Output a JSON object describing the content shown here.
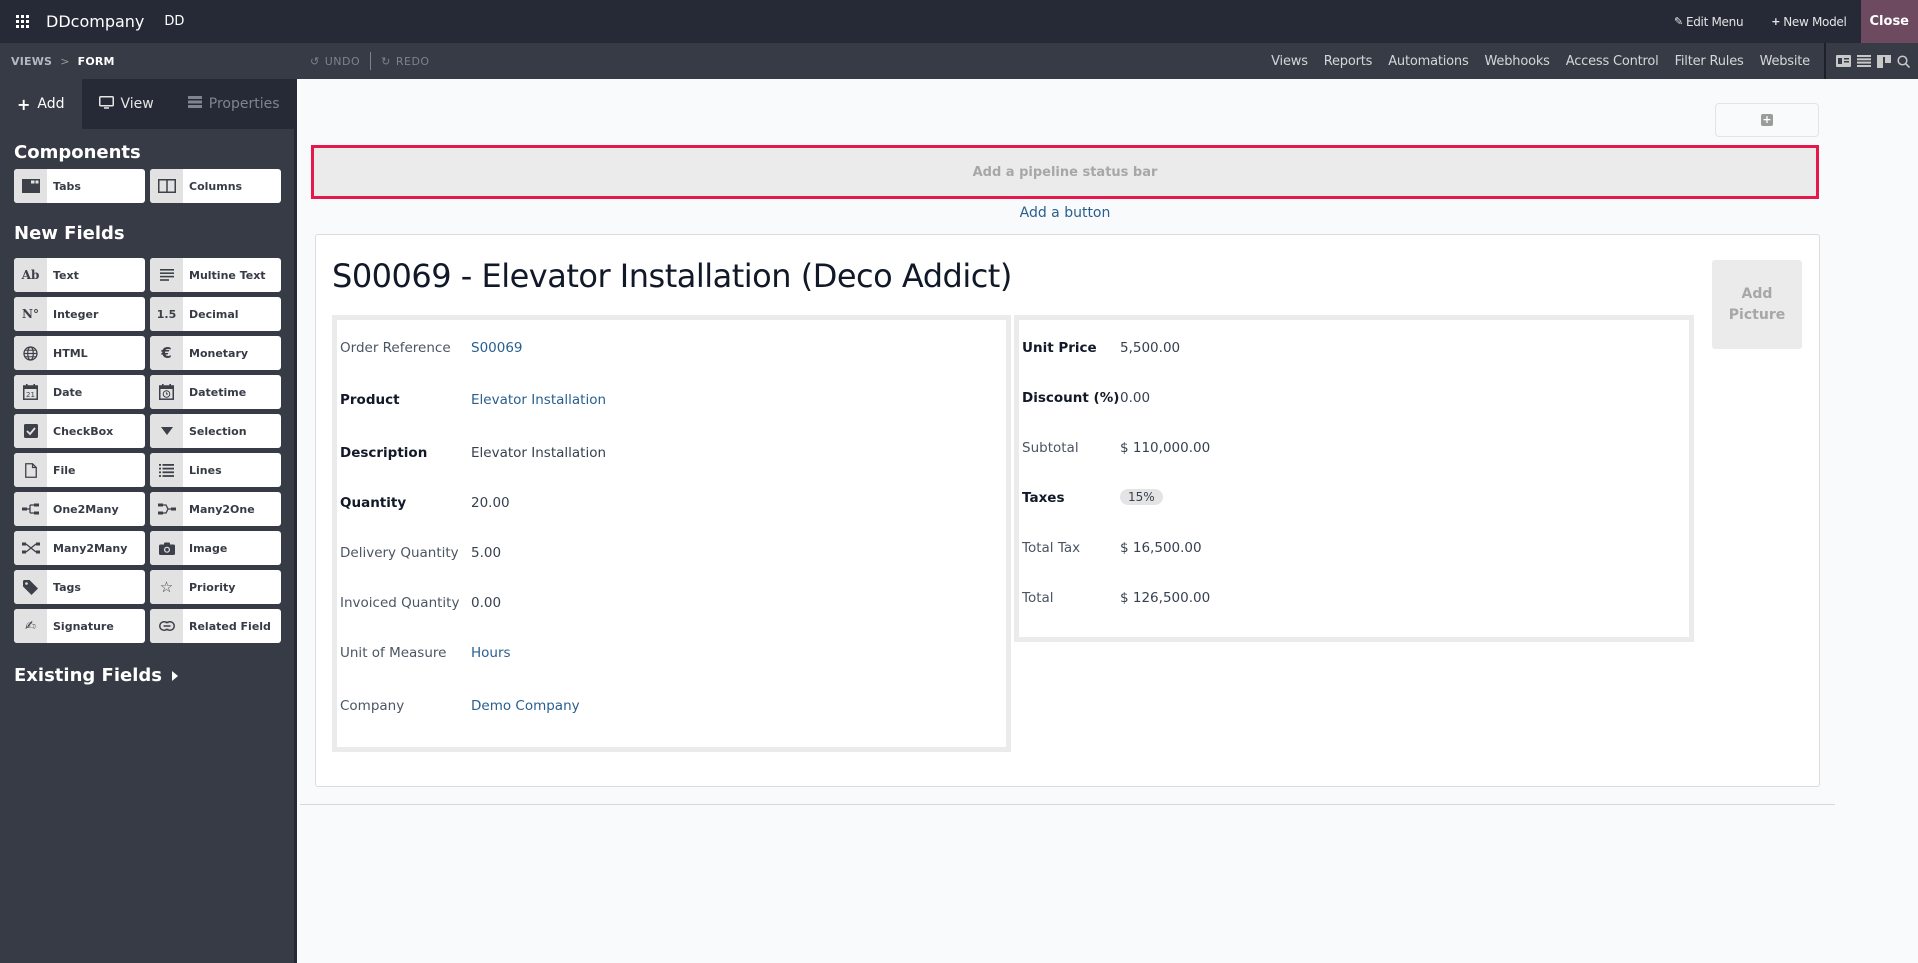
{
  "topbar": {
    "brand": "DDcompany",
    "company_short": "DD",
    "edit_menu": "Edit Menu",
    "new_model": "New Model",
    "close": "Close"
  },
  "subbar": {
    "breadcrumb": {
      "views": "VIEWS",
      "separator": ">",
      "form": "FORM"
    },
    "undo": "UNDO",
    "redo": "REDO",
    "menu": [
      "Views",
      "Reports",
      "Automations",
      "Webhooks",
      "Access Control",
      "Filter Rules",
      "Website"
    ],
    "view_icons": [
      "form-view-icon",
      "list-view-icon",
      "kanban-view-icon",
      "search-view-icon"
    ]
  },
  "sidebar": {
    "tabs": [
      {
        "label": "Add",
        "icon": "plus-icon",
        "state": "active"
      },
      {
        "label": "View",
        "icon": "monitor-icon",
        "state": "normal"
      },
      {
        "label": "Properties",
        "icon": "properties-icon",
        "state": "disabled"
      }
    ],
    "components_title": "Components",
    "components": [
      {
        "label": "Tabs",
        "icon": "tabs-icon"
      },
      {
        "label": "Columns",
        "icon": "columns-icon"
      }
    ],
    "new_fields_title": "New Fields",
    "new_fields": [
      {
        "label": "Text",
        "icon": "text-icon",
        "glyph": "Ab"
      },
      {
        "label": "Multine Text",
        "icon": "multiline-text-icon",
        "glyph": "≡"
      },
      {
        "label": "Integer",
        "icon": "integer-icon",
        "glyph": "N°"
      },
      {
        "label": "Decimal",
        "icon": "decimal-icon",
        "glyph": "1.5"
      },
      {
        "label": "HTML",
        "icon": "globe-icon",
        "glyph": "🌐"
      },
      {
        "label": "Monetary",
        "icon": "euro-icon",
        "glyph": "€"
      },
      {
        "label": "Date",
        "icon": "calendar-icon",
        "glyph": "21"
      },
      {
        "label": "Datetime",
        "icon": "calendar-clock-icon",
        "glyph": "◷"
      },
      {
        "label": "CheckBox",
        "icon": "checkbox-icon",
        "glyph": "☑"
      },
      {
        "label": "Selection",
        "icon": "caret-down-icon",
        "glyph": "▼"
      },
      {
        "label": "File",
        "icon": "file-icon",
        "glyph": "🗋"
      },
      {
        "label": "Lines",
        "icon": "list-icon",
        "glyph": "☰"
      },
      {
        "label": "One2Many",
        "icon": "one2many-icon",
        "glyph": "⋲"
      },
      {
        "label": "Many2One",
        "icon": "many2one-icon",
        "glyph": "⋺"
      },
      {
        "label": "Many2Many",
        "icon": "many2many-icon",
        "glyph": "⤨"
      },
      {
        "label": "Image",
        "icon": "camera-icon",
        "glyph": "📷"
      },
      {
        "label": "Tags",
        "icon": "tag-icon",
        "glyph": "🏷"
      },
      {
        "label": "Priority",
        "icon": "star-icon",
        "glyph": "☆"
      },
      {
        "label": "Signature",
        "icon": "signature-icon",
        "glyph": "✍"
      },
      {
        "label": "Related Field",
        "icon": "link-icon",
        "glyph": "⊂⊃"
      }
    ],
    "existing_fields_title": "Existing Fields"
  },
  "main": {
    "status_bar_placeholder": "Add a pipeline status bar",
    "add_button_link": "Add a button",
    "record_title": "S00069 - Elevator Installation (Deco Addict)",
    "add_picture": "Add Picture",
    "left_group": [
      {
        "label": "Order Reference",
        "value": "S00069",
        "bold": false,
        "link": true
      },
      {
        "label": "Product",
        "value": "Elevator Installation",
        "bold": true,
        "link": true
      },
      {
        "label": "Description",
        "value": "Elevator Installation",
        "bold": true,
        "link": false
      },
      {
        "label": "Quantity",
        "value": "20.00",
        "bold": true,
        "link": false
      },
      {
        "label": "Delivery Quantity",
        "value": "5.00",
        "bold": false,
        "link": false
      },
      {
        "label": "Invoiced Quantity",
        "value": "0.00",
        "bold": false,
        "link": false
      },
      {
        "label": "Unit of Measure",
        "value": "Hours",
        "bold": false,
        "link": true
      },
      {
        "label": "Company",
        "value": "Demo Company",
        "bold": false,
        "link": true
      }
    ],
    "right_group": [
      {
        "label": "Unit Price",
        "value": "5,500.00",
        "bold": true
      },
      {
        "label": "Discount (%)",
        "value": "0.00",
        "bold": true
      },
      {
        "label": "Subtotal",
        "value": "$ 110,000.00",
        "bold": false
      },
      {
        "label": "Taxes",
        "value": "15%",
        "bold": true,
        "badge": true
      },
      {
        "label": "Total Tax",
        "value": "$ 16,500.00",
        "bold": false
      },
      {
        "label": "Total",
        "value": "$ 126,500.00",
        "bold": false
      }
    ]
  },
  "colors": {
    "topbar": "#262a36",
    "subbar": "#373b45",
    "highlight_border": "#e5184b",
    "link": "#285f8f",
    "close_button": "#6d4a5f"
  }
}
